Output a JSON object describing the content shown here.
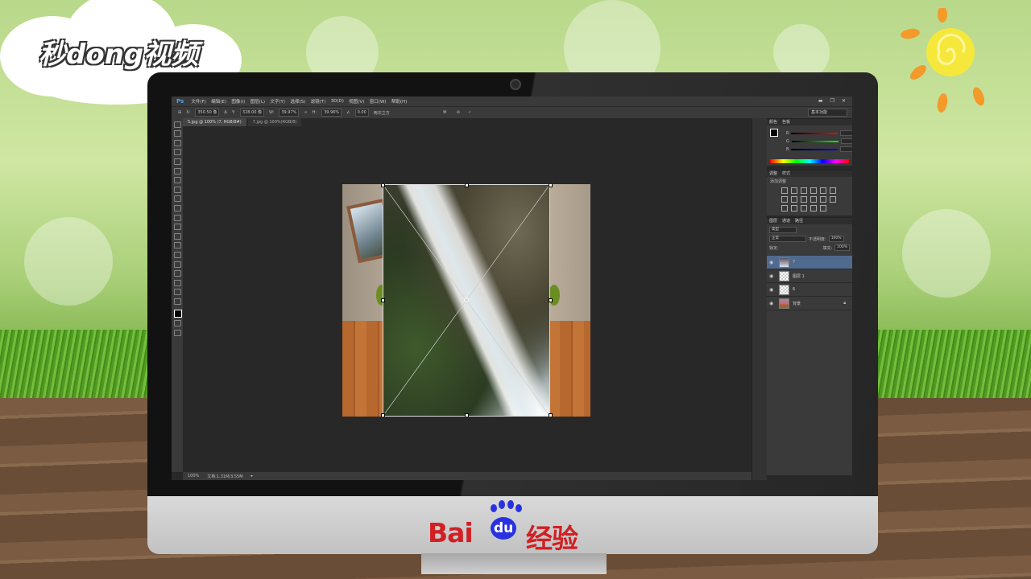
{
  "branding": {
    "top_logo": "秒dong视频",
    "bottom_logo_en": "Bai",
    "bottom_logo_du": "du",
    "bottom_logo_cn": "经验"
  },
  "ps": {
    "app_logo": "Ps",
    "menu": [
      "文件(F)",
      "编辑(E)",
      "图像(I)",
      "图层(L)",
      "文字(Y)",
      "选择(S)",
      "滤镜(T)",
      "3D(D)",
      "视图(V)",
      "窗口(W)",
      "帮助(H)"
    ],
    "window_controls": [
      "▬",
      "❐",
      "✕"
    ],
    "options": {
      "x": "350.50 像",
      "y": "328.00 像",
      "w": "39.97%",
      "h": "39.96%",
      "angle": "0.00",
      "interp": "两次立方",
      "warp_label": "变形模式"
    },
    "workspace": "基本功能",
    "tabs": [
      "5.jpg @ 100% (7, RGB/8#)",
      "7.jpg @ 100%(RGB/8)"
    ],
    "status": {
      "zoom": "100%",
      "doc": "文档:1.31M/3.55M"
    },
    "panels": {
      "color_tabs": [
        "颜色",
        "色板"
      ],
      "color_labels": [
        "R",
        "G",
        "B"
      ],
      "adjust_tabs": [
        "调整",
        "样式"
      ],
      "adjust_hint": "添加调整",
      "layers_tabs": [
        "图层",
        "通道",
        "路径"
      ],
      "layers_kind": "类型",
      "blend_mode": "正常",
      "opacity_label": "不透明度:",
      "opacity": "100%",
      "lock_label": "锁定:",
      "fill_label": "填充:",
      "fill": "100%",
      "layers": [
        {
          "name": "7",
          "selected": true
        },
        {
          "name": "图层 1",
          "selected": false
        },
        {
          "name": "6",
          "selected": false
        },
        {
          "name": "背景",
          "selected": false
        }
      ]
    }
  }
}
